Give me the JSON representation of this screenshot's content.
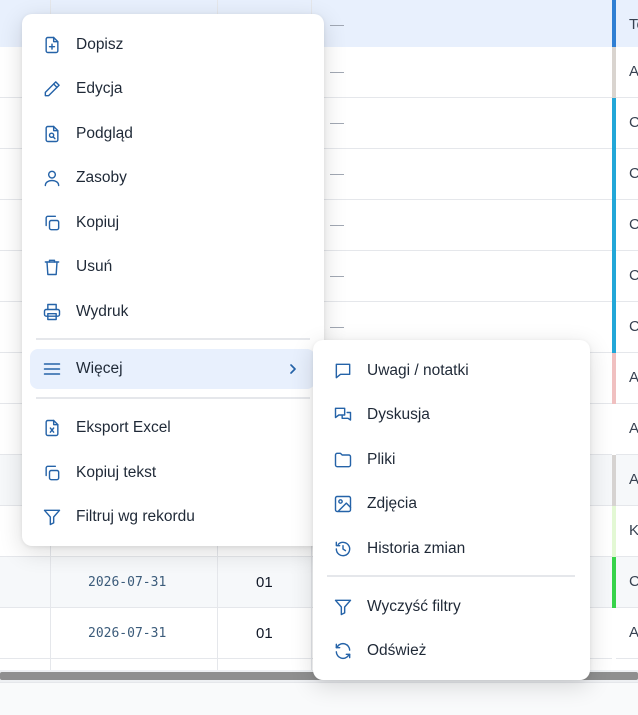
{
  "grid": {
    "rows": [
      {
        "dash": "—",
        "edge_text": "Te",
        "edge_color": "#2f7fd3",
        "date": "",
        "code": ""
      },
      {
        "dash": "—",
        "edge_text": "A",
        "edge_color": "#d9d4cf",
        "date": "",
        "code": ""
      },
      {
        "dash": "—",
        "edge_text": "C",
        "edge_color": "#22a7d8",
        "date": "",
        "code": ""
      },
      {
        "dash": "—",
        "edge_text": "C",
        "edge_color": "#22a7d8",
        "date": "",
        "code": ""
      },
      {
        "dash": "—",
        "edge_text": "C",
        "edge_color": "#22a7d8",
        "date": "",
        "code": ""
      },
      {
        "dash": "—",
        "edge_text": "C",
        "edge_color": "#22a7d8",
        "date": "",
        "code": ""
      },
      {
        "dash": "—",
        "edge_text": "C",
        "edge_color": "#22a7d8",
        "date": "",
        "code": ""
      },
      {
        "dash": "",
        "edge_text": "A",
        "edge_color": "#f0c0c0",
        "date": "",
        "code": ""
      },
      {
        "dash": "",
        "edge_text": "A",
        "edge_color": "#ffffff",
        "date": "",
        "code": ""
      },
      {
        "dash": "",
        "edge_text": "A",
        "edge_color": "#d6d3d1",
        "date": "",
        "code": ""
      },
      {
        "dash": "",
        "edge_text": "K",
        "edge_color": "#e3f8d4",
        "date": "",
        "code": ""
      },
      {
        "dash": "",
        "edge_text": "C",
        "edge_color": "#37d34a",
        "date": "2026-07-31",
        "code": "01"
      },
      {
        "dash": "",
        "edge_text": "A",
        "edge_color": "#ffffff",
        "date": "2026-07-31",
        "code": "01"
      }
    ]
  },
  "context_menu": {
    "items": [
      {
        "label": "Dopisz",
        "icon": "file-plus-icon"
      },
      {
        "label": "Edycja",
        "icon": "pencil-icon"
      },
      {
        "label": "Podgląd",
        "icon": "file-search-icon"
      },
      {
        "label": "Zasoby",
        "icon": "user-icon"
      },
      {
        "label": "Kopiuj",
        "icon": "copy-icon"
      },
      {
        "label": "Usuń",
        "icon": "trash-icon"
      },
      {
        "label": "Wydruk",
        "icon": "printer-icon"
      },
      {
        "label": "Więcej",
        "icon": "menu-lines-icon"
      },
      {
        "label": "Eksport Excel",
        "icon": "file-excel-icon"
      },
      {
        "label": "Kopiuj tekst",
        "icon": "copy-text-icon"
      },
      {
        "label": "Filtruj wg rekordu",
        "icon": "filter-icon"
      }
    ]
  },
  "submenu": {
    "items": [
      {
        "label": "Uwagi / notatki",
        "icon": "comment-icon"
      },
      {
        "label": "Dyskusja",
        "icon": "discussion-icon"
      },
      {
        "label": "Pliki",
        "icon": "folder-icon"
      },
      {
        "label": "Zdjęcia",
        "icon": "image-icon"
      },
      {
        "label": "Historia zmian",
        "icon": "history-icon"
      },
      {
        "label": "Wyczyść filtry",
        "icon": "filter-clear-icon"
      },
      {
        "label": "Odśwież",
        "icon": "refresh-icon"
      }
    ]
  },
  "colors": {
    "icon": "#2563a8",
    "highlight": "#e8f0fd"
  }
}
